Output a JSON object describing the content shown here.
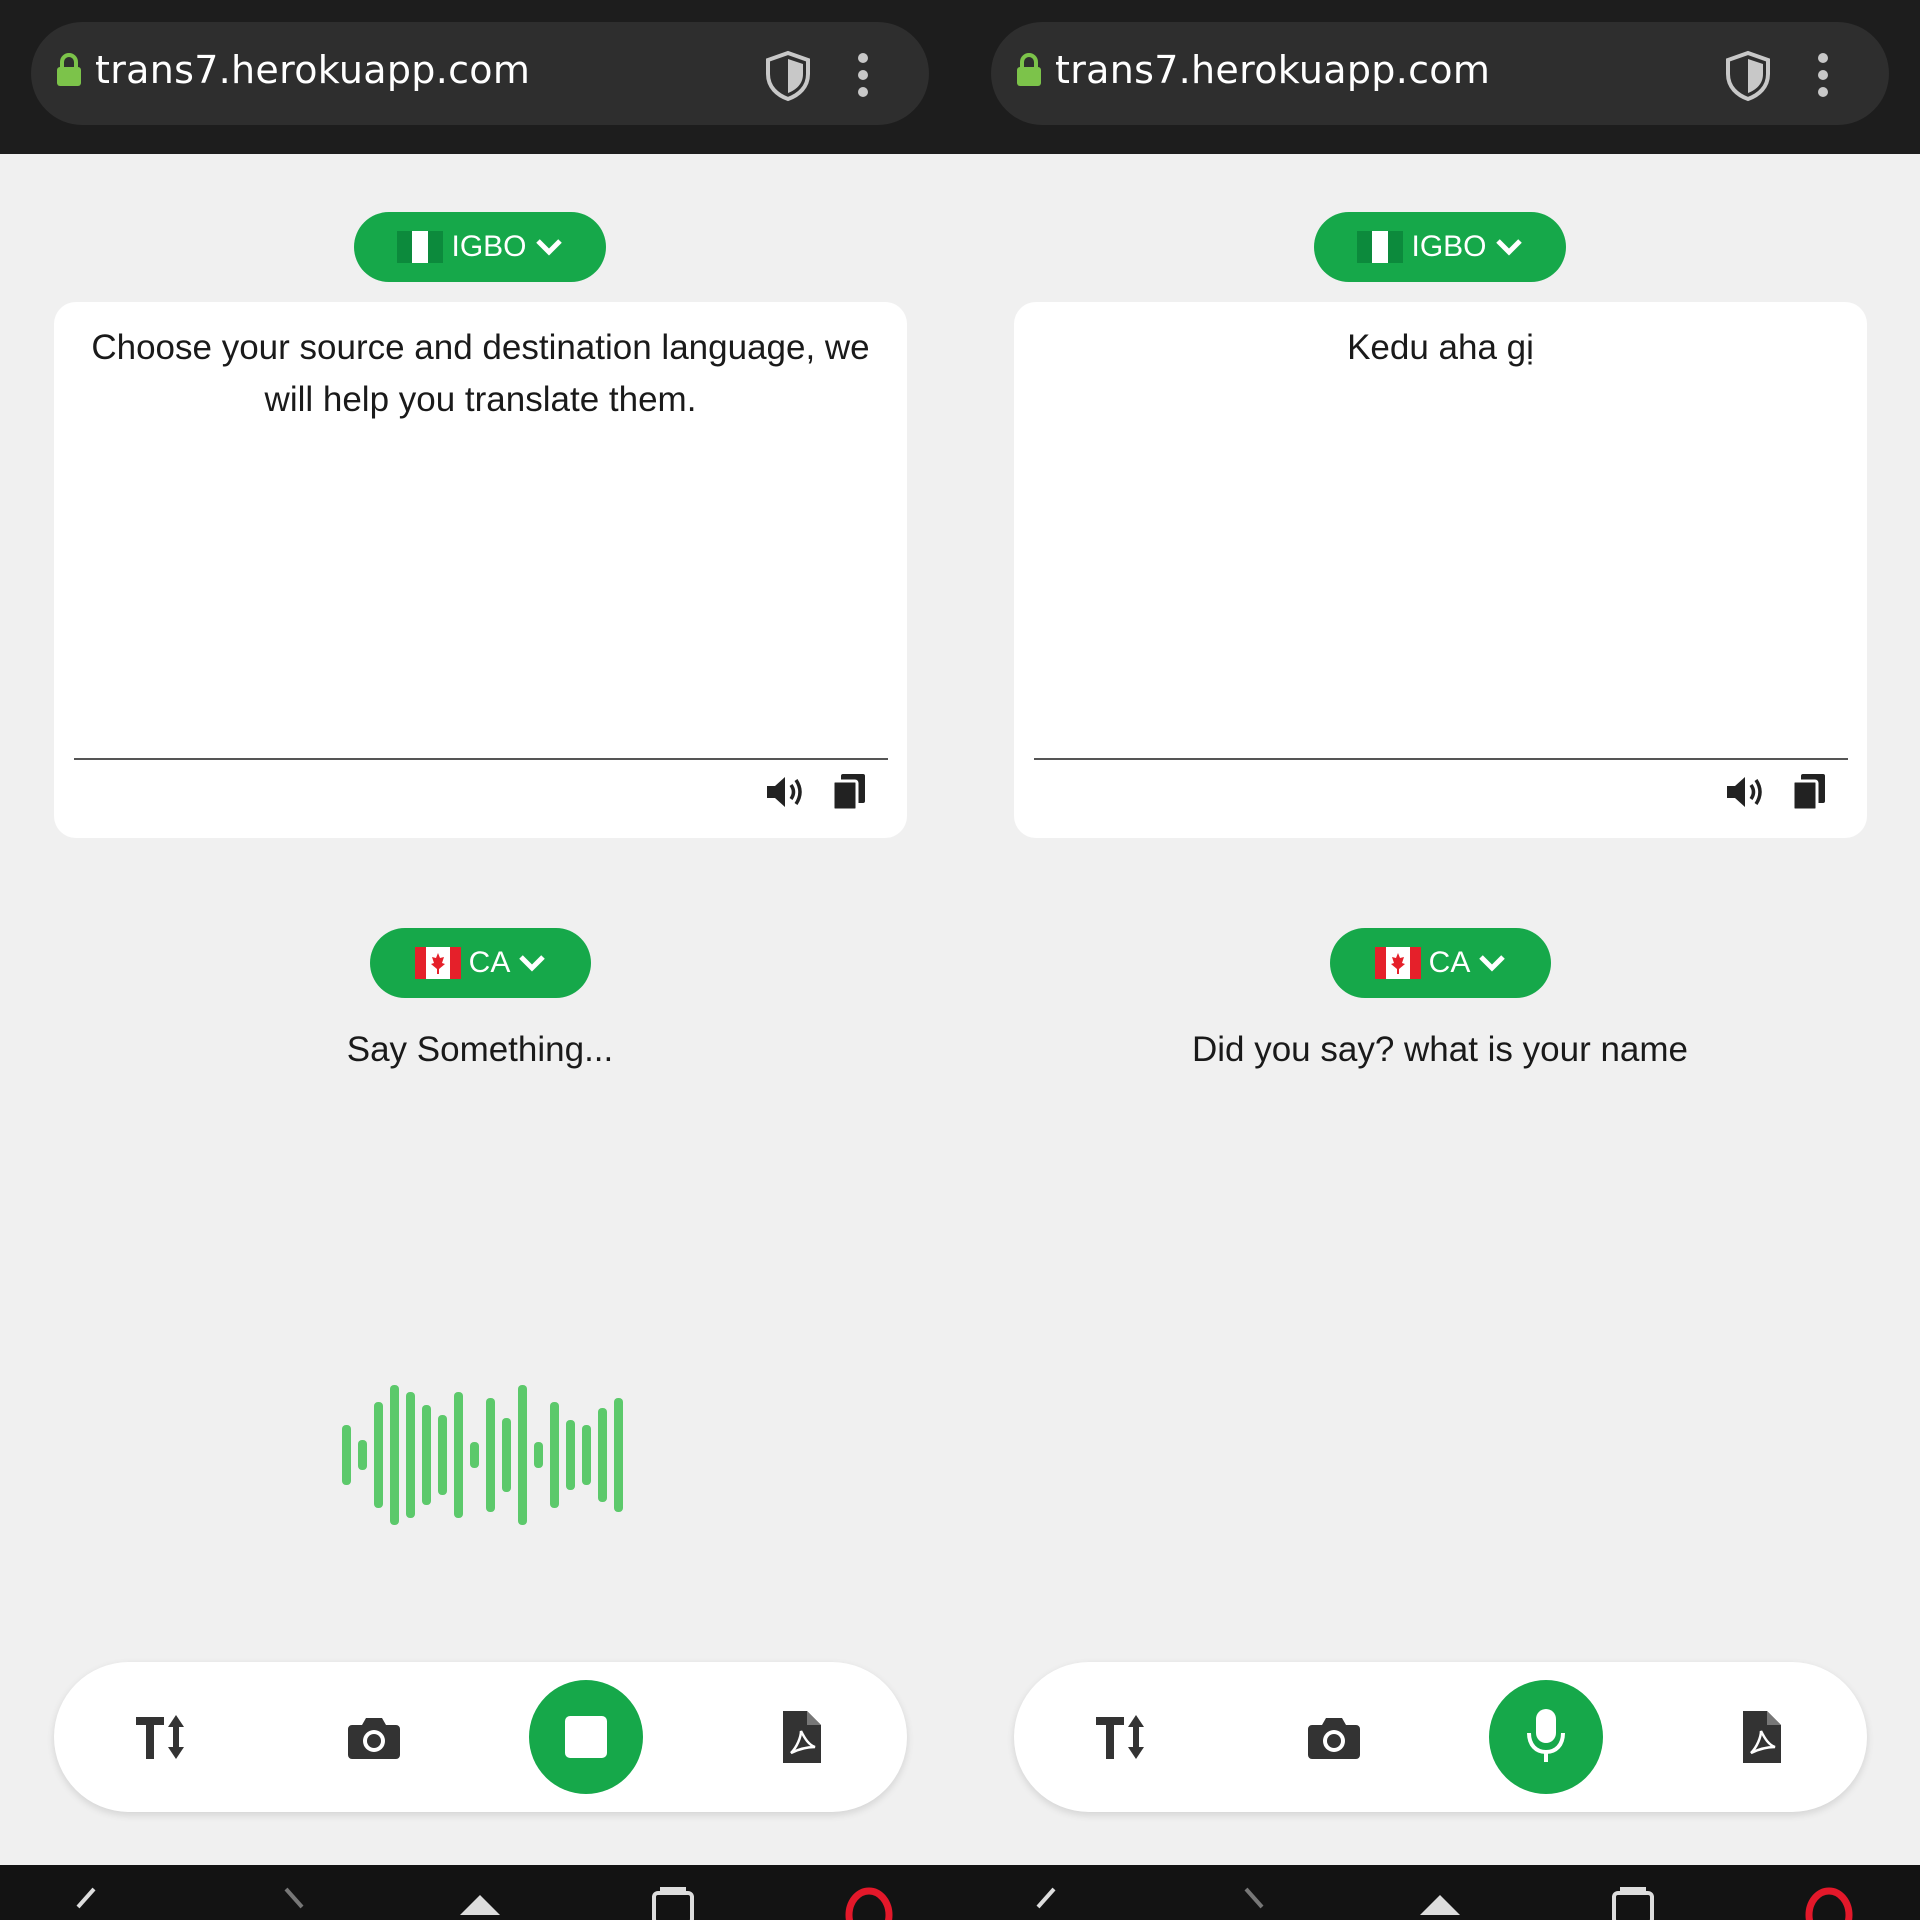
{
  "colors": {
    "accent": "#16a84a",
    "browser_bar": "#1d1d1d",
    "page_bg": "#f0f0f0",
    "wave": "#5cc96b",
    "lock": "#7cc34a"
  },
  "left_panel": {
    "url": "trans7.herokuapp.com",
    "source_language": {
      "label": "IGBO",
      "flag": "nigeria-flag"
    },
    "output_text": "Choose your source and destination language, we will help you translate them.",
    "target_language": {
      "label": "CA",
      "flag": "canada-flag"
    },
    "speech_prompt": "Say Something...",
    "recording": true,
    "main_button_icon": "stop-icon"
  },
  "right_panel": {
    "url": "trans7.herokuapp.com",
    "source_language": {
      "label": "IGBO",
      "flag": "nigeria-flag"
    },
    "output_text": "Kedu aha gị",
    "target_language": {
      "label": "CA",
      "flag": "canada-flag"
    },
    "speech_prompt": "Did you say? what is your name",
    "recording": false,
    "main_button_icon": "microphone-icon"
  },
  "toolbar_icons": [
    "text-size-icon",
    "camera-icon",
    "main-action",
    "pdf-icon"
  ]
}
